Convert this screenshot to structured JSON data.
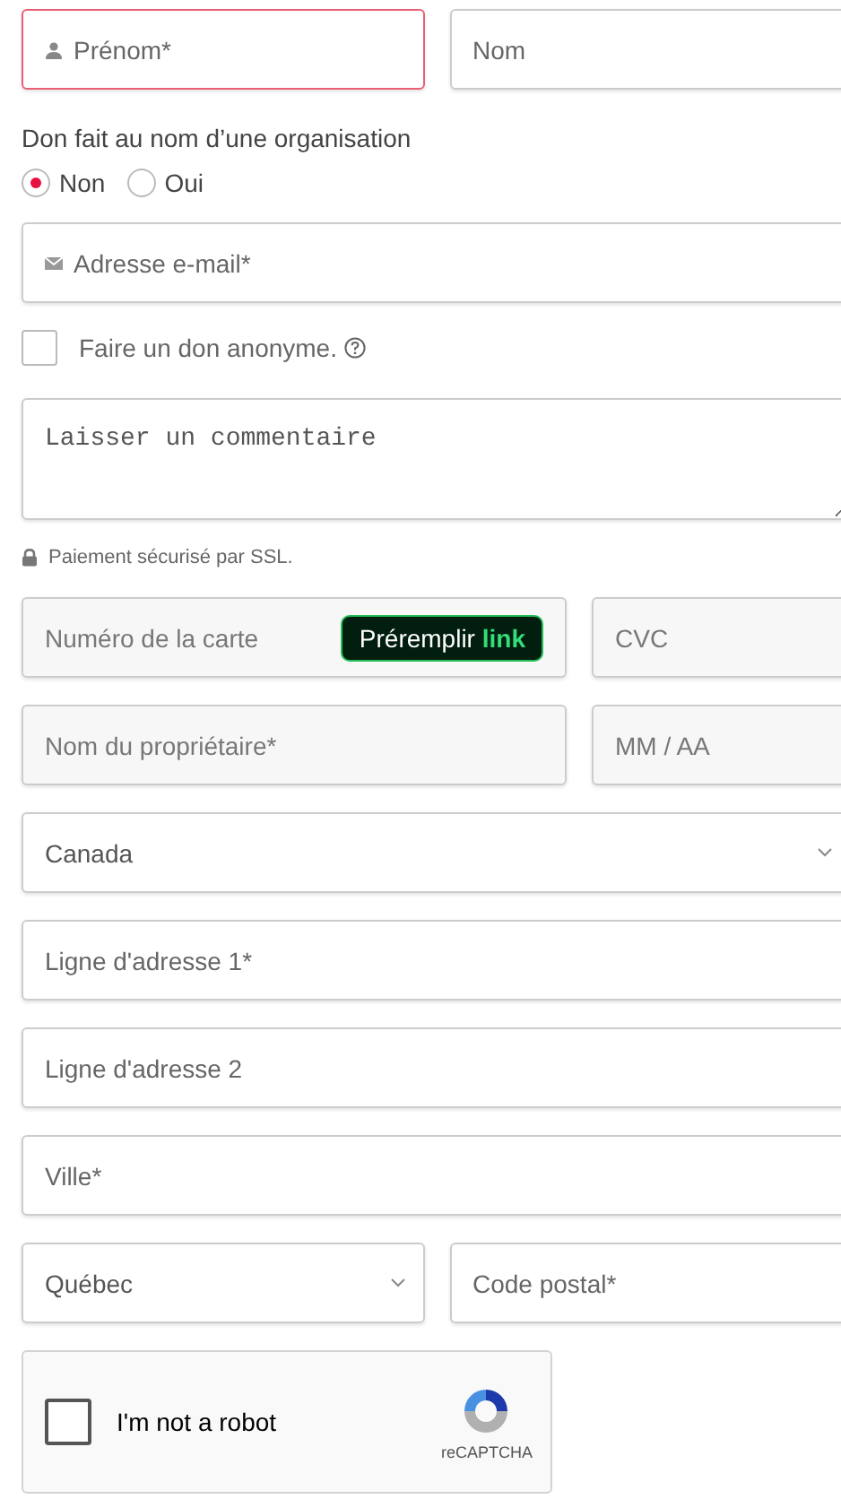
{
  "name_row": [
    {
      "kind": "text",
      "placeholder": "Prénom*",
      "error": true
    },
    {
      "kind": "text",
      "placeholder": "Nom",
      "error": false
    }
  ],
  "organisation": {
    "label": "Don fait au nom d’une organisation",
    "options": [
      {
        "label": "Non",
        "selected": true
      },
      {
        "label": "Oui",
        "selected": false
      }
    ]
  },
  "email": {
    "kind": "text",
    "placeholder": "Adresse e-mail*",
    "error": false
  },
  "anonymous": {
    "label": "Faire un don anonyme.",
    "checked": false
  },
  "comment": {
    "kind": "textarea",
    "placeholder": "Laisser un commentaire"
  },
  "secure_note": "Paiement sécurisé par SSL.",
  "card_rows": [
    [
      {
        "kind": "text",
        "placeholder": "Numéro de la carte",
        "button": "Préremplir **link**",
        "error": false
      },
      {
        "kind": "text",
        "placeholder": "CVC",
        "error": false
      }
    ],
    [
      {
        "kind": "text",
        "placeholder": "Nom du propriétaire*",
        "error": false
      },
      {
        "kind": "text",
        "placeholder": "MM / AA",
        "error": false
      }
    ]
  ],
  "address_rows": [
    [
      {
        "kind": "select",
        "value": "Canada"
      }
    ],
    [
      {
        "kind": "text",
        "placeholder": "Ligne d'adresse 1*",
        "error": false
      }
    ],
    [
      {
        "kind": "text",
        "placeholder": "Ligne d'adresse 2",
        "error": false
      }
    ],
    [
      {
        "kind": "text",
        "placeholder": "Ville*",
        "error": false
      }
    ],
    [
      {
        "kind": "select",
        "value": "Québec"
      },
      {
        "kind": "text",
        "placeholder": "Code postal*",
        "error": false
      }
    ]
  ],
  "captcha": {
    "label": "I'm not a robot",
    "brand": "reCAPTCHA",
    "checked": false
  }
}
